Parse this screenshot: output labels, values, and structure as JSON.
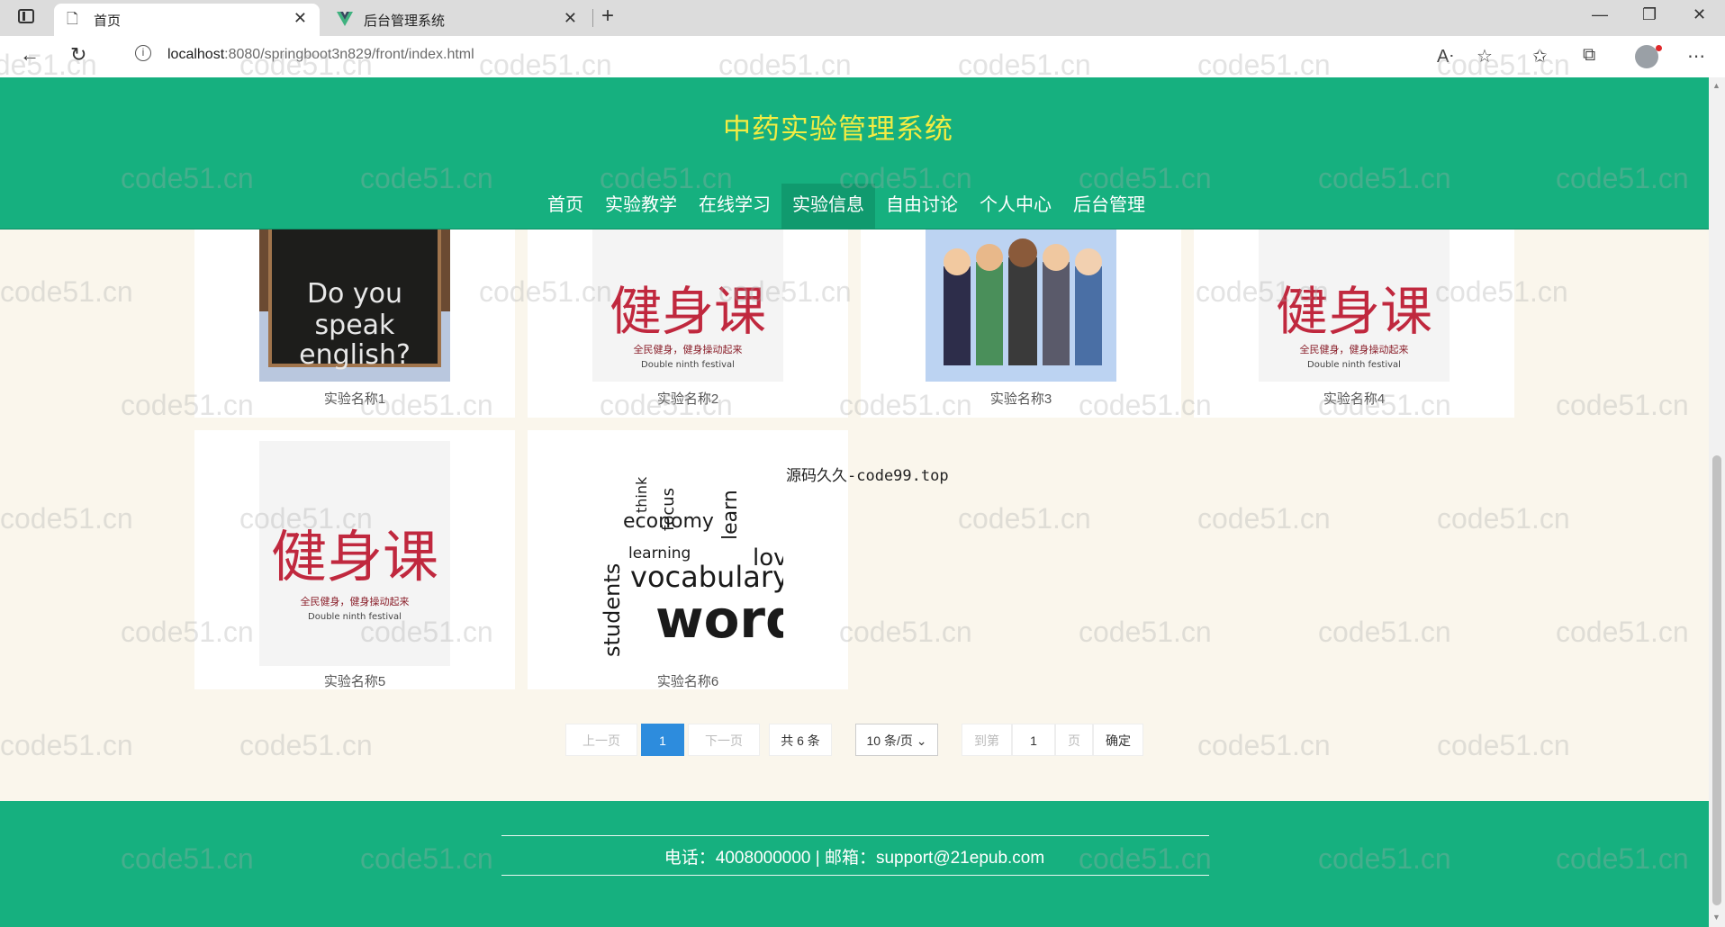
{
  "browser": {
    "tabs": [
      {
        "title": "首页",
        "icon": "page-icon"
      },
      {
        "title": "后台管理系统",
        "icon": "vue-logo-icon"
      }
    ],
    "url_host": "localhost",
    "url_rest": ":8080/springboot3n829/front/index.html"
  },
  "site": {
    "title": "中药实验管理系统",
    "nav": [
      "首页",
      "实验教学",
      "在线学习",
      "实验信息",
      "自由讨论",
      "个人中心",
      "后台管理"
    ],
    "active_nav": "实验信息"
  },
  "cards": [
    {
      "title": "实验名称1",
      "image": "do-you-speak-english-sign"
    },
    {
      "title": "实验名称2",
      "image": "jian-shen-ke-calligraphy"
    },
    {
      "title": "实验名称3",
      "image": "cartoon-students-group"
    },
    {
      "title": "实验名称4",
      "image": "jian-shen-ke-calligraphy"
    },
    {
      "title": "实验名称5",
      "image": "jian-shen-ke-calligraphy"
    },
    {
      "title": "实验名称6",
      "image": "vocabulary-words-cloud"
    }
  ],
  "images": {
    "sign_lines": [
      "Do you",
      "speak",
      "english?"
    ],
    "calligraphy_chars": "健身课",
    "calligraphy_line1": "全民健身，健身操动起来",
    "calligraphy_line2": "Double ninth festival",
    "wordcloud": [
      "vocabulary",
      "words",
      "students",
      "economy",
      "learning",
      "love",
      "learn",
      "focus",
      "think"
    ]
  },
  "notice": "源码久久-code99.top",
  "pagination": {
    "prev": "上一页",
    "current": "1",
    "next": "下一页",
    "total": "共 6 条",
    "page_size": "10 条/页",
    "goto": "到第",
    "goto_value": "1",
    "page_unit": "页",
    "confirm": "确定"
  },
  "footer": {
    "text": "电话：4008000000 | 邮箱：support@21epub.com"
  },
  "watermark": "code51.cn"
}
